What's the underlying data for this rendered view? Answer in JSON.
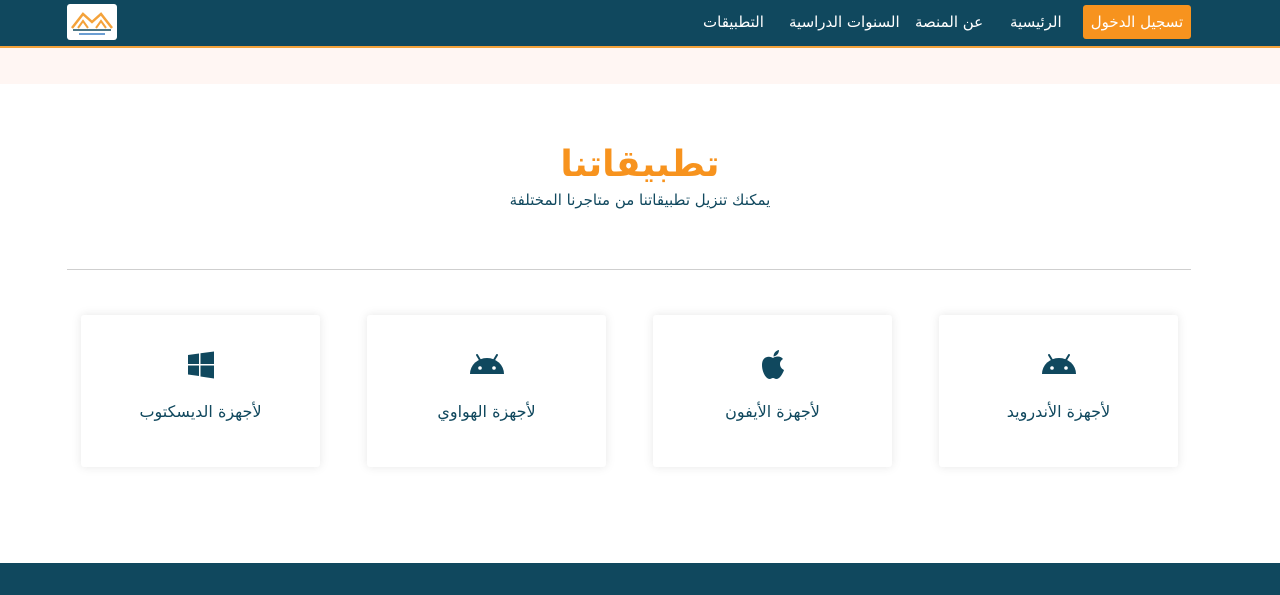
{
  "nav": {
    "login_label": "تسجيل الدخول",
    "links": [
      {
        "label": "الرئيسية"
      },
      {
        "label": "عن المنصة"
      },
      {
        "label": "السنوات الدراسية"
      },
      {
        "label": "التطبيقات"
      }
    ]
  },
  "hero": {
    "title": "تطبيقاتنا",
    "subtitle": "يمكنك تنزيل تطبيقاتنا من متاجرنا المختلفة"
  },
  "cards": [
    {
      "icon": "android-icon",
      "label": "لأجهزة الأندرويد"
    },
    {
      "icon": "apple-icon",
      "label": "لأجهزة الأيفون"
    },
    {
      "icon": "android-icon",
      "label": "لأجهزة الهواوي"
    },
    {
      "icon": "windows-icon",
      "label": "لأجهزة الديسكتوب"
    }
  ],
  "colors": {
    "primary": "#10485e",
    "accent": "#f7931e",
    "strip": "#fff6f3"
  }
}
